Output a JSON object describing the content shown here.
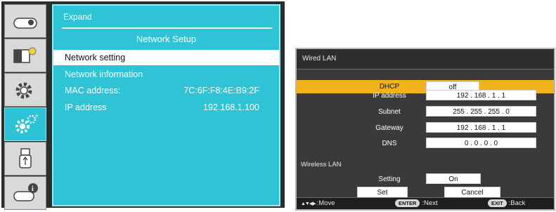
{
  "left_menu": {
    "tabs": [
      {
        "icon": "projector-icon",
        "active": false
      },
      {
        "icon": "picture-adjust-icon",
        "active": false
      },
      {
        "icon": "settings-gear-icon",
        "active": false
      },
      {
        "icon": "expand-settings-icon",
        "active": true
      },
      {
        "icon": "usb-icon",
        "active": false
      },
      {
        "icon": "projector-info-icon",
        "active": false
      }
    ],
    "breadcrumb": "Expand",
    "panel_title": "Network Setup",
    "rows": [
      {
        "label": "Network setting",
        "value": "",
        "selected": true
      },
      {
        "label": "Network information",
        "value": "",
        "selected": false
      },
      {
        "label": "MAC address:",
        "value": "7C:6F:F8:4E:B9:2F",
        "selected": false
      },
      {
        "label": "IP address",
        "value": "192.168.1.100",
        "selected": false
      }
    ],
    "colors": {
      "panel": "#2ec4d6",
      "frame": "#2d2d2d"
    }
  },
  "dialog": {
    "title": "Wired LAN",
    "dhcp": {
      "label": "DHCP",
      "value": "off"
    },
    "fields": [
      {
        "label": "IP address",
        "value": "192 . 168 .   1 . 1"
      },
      {
        "label": "Subnet",
        "value": "255 . 255 . 255 . 0"
      },
      {
        "label": "Gateway",
        "value": "192 . 168 .   1 . 1"
      },
      {
        "label": "DNS",
        "value": "0   .   0   .   0   .  0"
      }
    ],
    "wireless_title": "Wireless LAN",
    "wireless_setting": {
      "label": "Setting",
      "value": "On"
    },
    "set_button": "Set",
    "cancel_button": "Cancel",
    "footer": {
      "move_label": ":Move",
      "enter_key": "ENTER",
      "next_label": ":Next",
      "exit_key": "EXIT",
      "back_label": ":Back"
    },
    "colors": {
      "highlight": "#f2b21a",
      "background": "#3a3a3a"
    }
  }
}
